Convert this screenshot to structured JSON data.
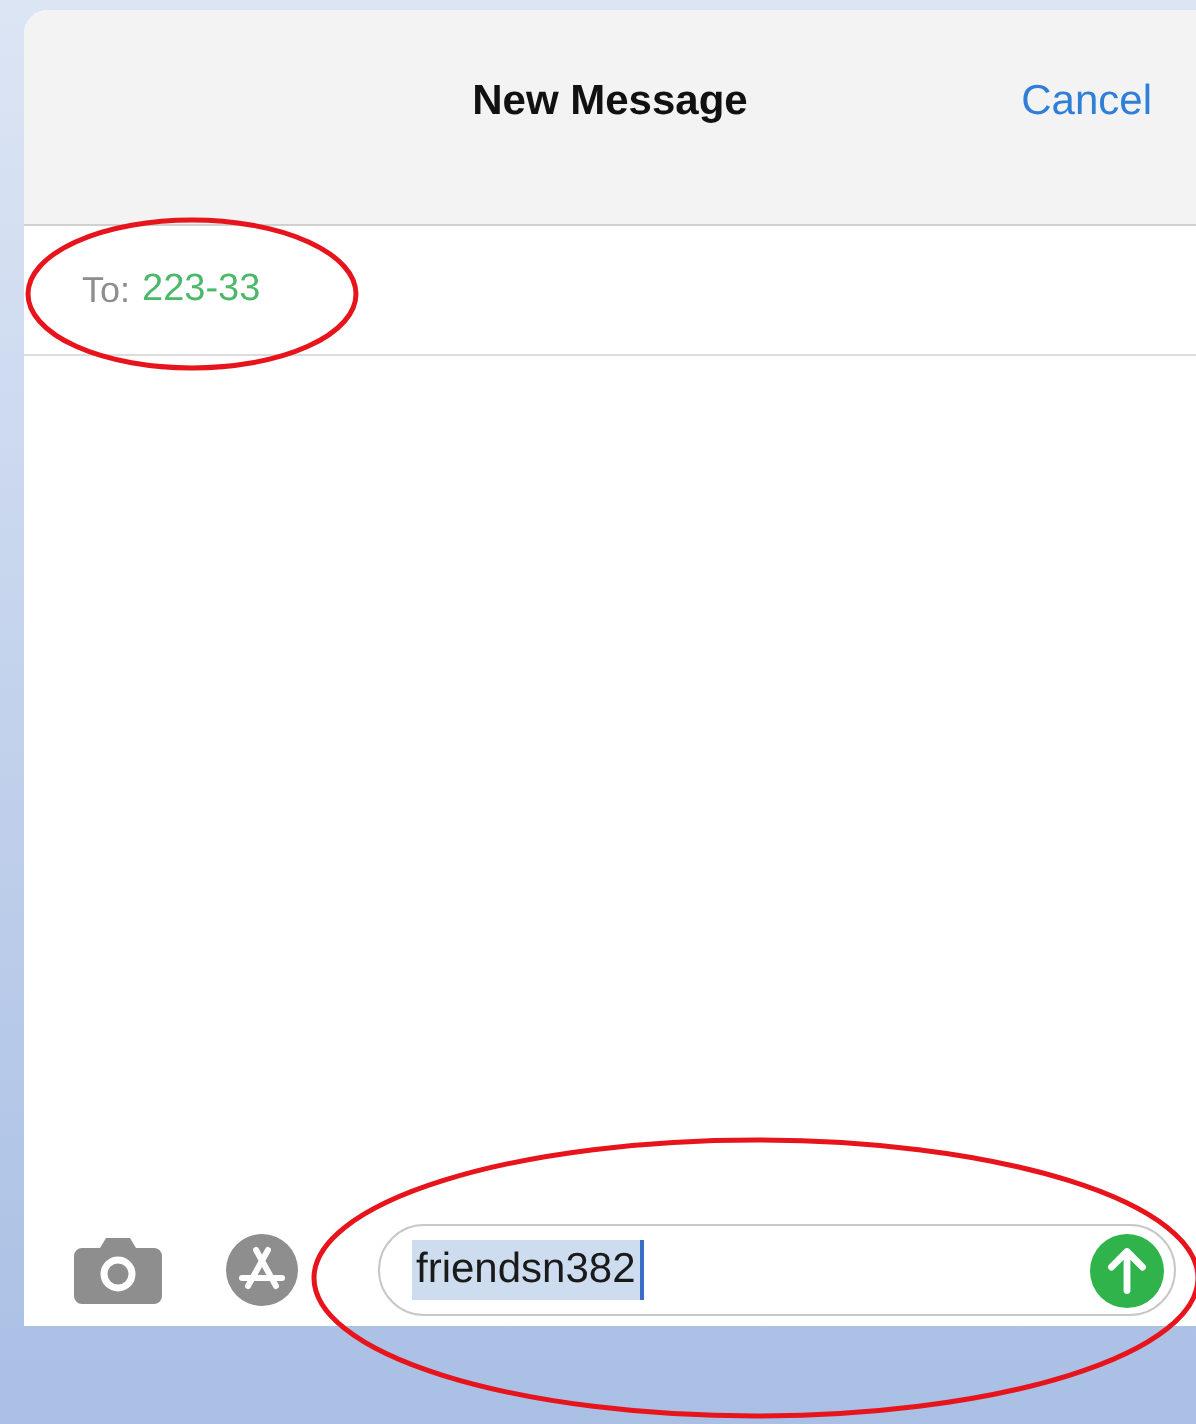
{
  "header": {
    "title": "New Message",
    "cancel": "Cancel"
  },
  "recipient": {
    "label": "To:",
    "value": "223-33",
    "circled": true
  },
  "compose": {
    "value": "friendsn382",
    "highlighted": true,
    "circled": true
  }
}
